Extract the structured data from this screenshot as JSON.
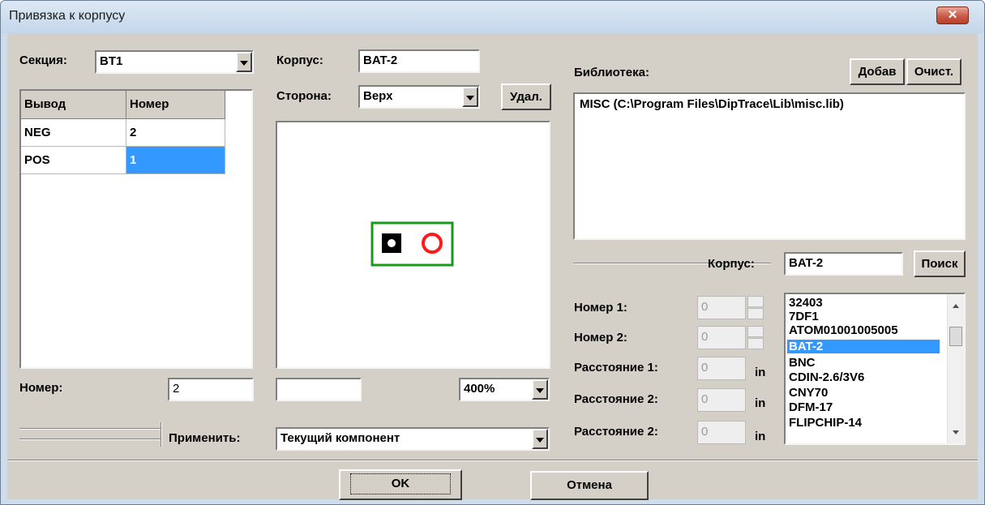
{
  "window": {
    "title": "Привязка к корпусу",
    "close_glyph": "✕"
  },
  "section": {
    "label": "Секция:",
    "value": "BT1"
  },
  "pins_table": {
    "headers": [
      "Вывод",
      "Номер"
    ],
    "rows": [
      {
        "pin": "NEG",
        "number": "2"
      },
      {
        "pin": "POS",
        "number": "1"
      }
    ],
    "selected_row": 1
  },
  "number_field": {
    "label": "Номер:",
    "value": "2"
  },
  "apply": {
    "label": "Применить:",
    "value": "Текущий компонент"
  },
  "package": {
    "label": "Корпус:",
    "value": "BAT-2"
  },
  "side": {
    "label": "Сторона:",
    "value": "Верх"
  },
  "delete_button": "Удал.",
  "zoom": {
    "value": "400%",
    "coord_value": ""
  },
  "library": {
    "label": "Библиотека:",
    "add_button": "Добав",
    "clear_button": "Очист.",
    "items": [
      "MISC (C:\\Program Files\\DipTrace\\Lib\\misc.lib)"
    ]
  },
  "package_search": {
    "label": "Корпус:",
    "value": "BAT-2",
    "search_button": "Поиск"
  },
  "pad_params": {
    "number1_label": "Номер 1:",
    "number1_value": "0",
    "number2_label": "Номер 2:",
    "number2_value": "0",
    "distance1_label": "Расстояние 1:",
    "distance1_value": "0",
    "distance2a_label": "Расстояние 2:",
    "distance2a_value": "0",
    "distance2b_label": "Расстояние 2:",
    "distance2b_value": "0",
    "unit": "in"
  },
  "package_list": {
    "items": [
      "32403",
      "7DF1",
      "ATOM01001005005",
      "BAT-2",
      "BNC",
      "CDIN-2.6/3V6",
      "CNY70",
      "DFM-17",
      "FLIPCHIP-14"
    ],
    "selected": "BAT-2"
  },
  "footer": {
    "ok_button": "OK",
    "cancel_button": "Отмена"
  },
  "colors": {
    "selection": "#3399ff",
    "pad_outline": "#1a9a1a",
    "pad_red": "#ff1a1a"
  }
}
